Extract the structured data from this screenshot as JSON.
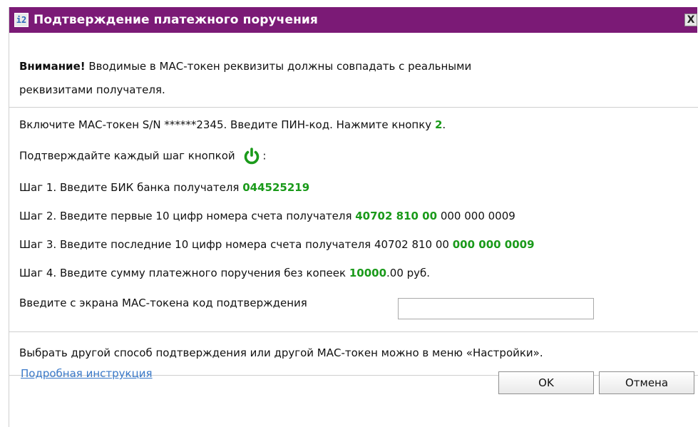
{
  "window": {
    "title": "Подтверждение платежного поручения",
    "app_icon_text": "i2",
    "close_label": "X"
  },
  "warning": {
    "bold": "Внимание!",
    "line1_rest": " Вводимые в МАС-токен реквизиты должны совпадать с реальными",
    "line2": "реквизитами получателя."
  },
  "instructions": {
    "enable_text": "Включите МАС-токен S/N ******2345. Введите ПИН-код. Нажмите кнопку ",
    "enable_key": "2",
    "enable_end": ".",
    "confirm_text": "Подтверждайте каждый шаг кнопкой",
    "confirm_end": ":",
    "step1_text": "Шаг 1. Введите БИК банка получателя ",
    "step1_value": "044525219",
    "step2_text": "Шаг 2. Введите первые 10 цифр номера счета получателя ",
    "step2_value": "40702 810 00",
    "step2_rest": " 000 000 0009",
    "step3_text": "Шаг 3. Введите последние 10 цифр номера счета получателя 40702 810 00 ",
    "step3_value": "000 000 0009",
    "step4_text": "Шаг 4. Введите сумму платежного поручения без копеек ",
    "step4_value": "10000",
    "step4_rest": ".00 руб."
  },
  "code_field": {
    "label": "Введите с экрана МАС-токена код подтверждения",
    "value": ""
  },
  "footer_note": "Выбрать другой способ подтверждения или другой МАС-токен можно в меню «Настройки».",
  "help_link": "Подробная инструкция",
  "buttons": {
    "ok": "OK",
    "cancel": "Отмена"
  },
  "colors": {
    "titlebar": "#7b1a76",
    "highlight": "#1a9a1a",
    "link": "#3a79c8"
  },
  "icons": {
    "power": "power-icon"
  }
}
